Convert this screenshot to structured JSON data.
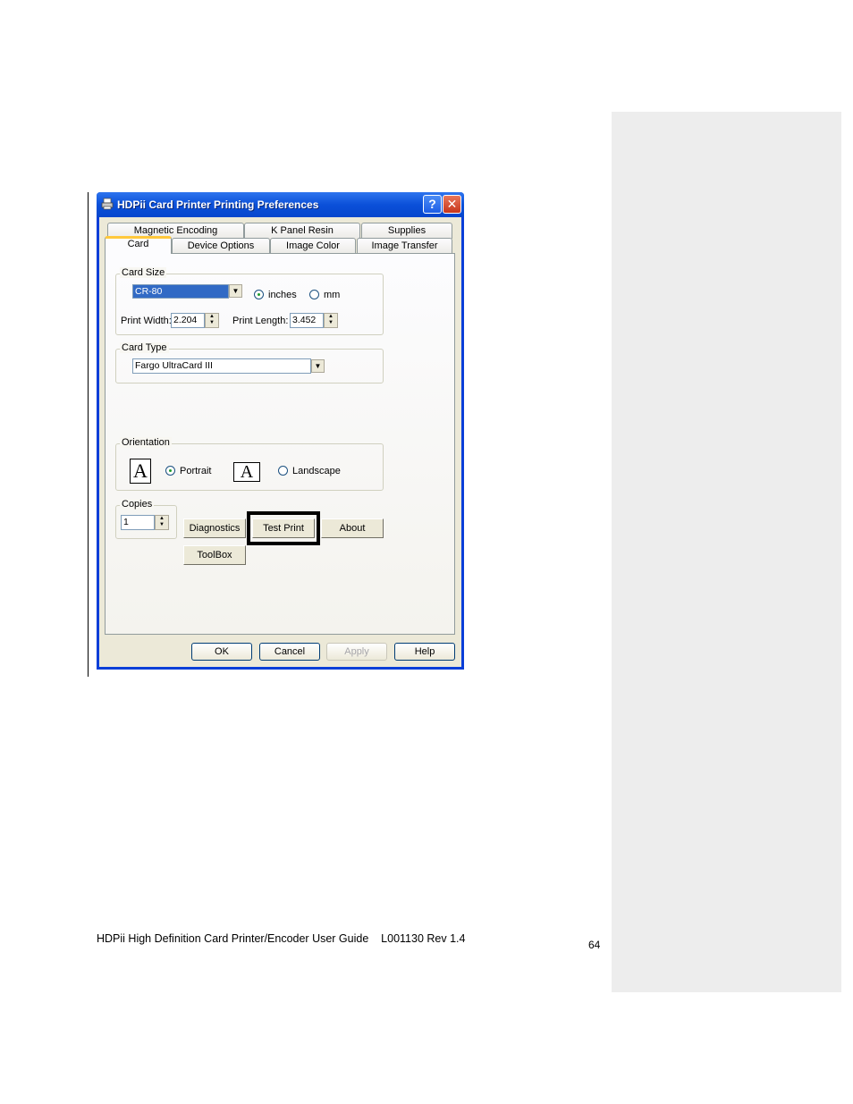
{
  "window": {
    "title": "HDPii Card Printer Printing Preferences",
    "help_glyph": "?",
    "close_glyph": "✕"
  },
  "tabs_row1": [
    {
      "label": "Magnetic Encoding"
    },
    {
      "label": "K Panel Resin"
    },
    {
      "label": "Supplies"
    }
  ],
  "tabs_row2": [
    {
      "label": "Card",
      "active": true
    },
    {
      "label": "Device Options"
    },
    {
      "label": "Image Color"
    },
    {
      "label": "Image Transfer"
    }
  ],
  "card_size": {
    "group_label": "Card Size",
    "selected": "CR-80",
    "unit_inches": "inches",
    "unit_mm": "mm",
    "unit_selected": "inches",
    "print_width_label": "Print Width:",
    "print_width": "2.204",
    "print_length_label": "Print Length:",
    "print_length": "3.452"
  },
  "card_type": {
    "group_label": "Card Type",
    "selected": "Fargo UltraCard III"
  },
  "orientation": {
    "group_label": "Orientation",
    "portrait": "Portrait",
    "landscape": "Landscape",
    "selected": "Portrait",
    "icon_letter": "A"
  },
  "copies": {
    "group_label": "Copies",
    "value": "1"
  },
  "buttons": {
    "diagnostics": "Diagnostics",
    "test_print": "Test Print",
    "about": "About",
    "toolbox": "ToolBox",
    "ok": "OK",
    "cancel": "Cancel",
    "apply": "Apply",
    "help": "Help"
  },
  "footer": {
    "text": "HDPii High Definition Card Printer/Encoder User Guide    L001130 Rev 1.4",
    "page_number": "64"
  },
  "colors": {
    "titlebar": "#0b50d9",
    "dialog_bg": "#ece9d8",
    "selection": "#316ac5",
    "comment_bar": "#ededed"
  }
}
